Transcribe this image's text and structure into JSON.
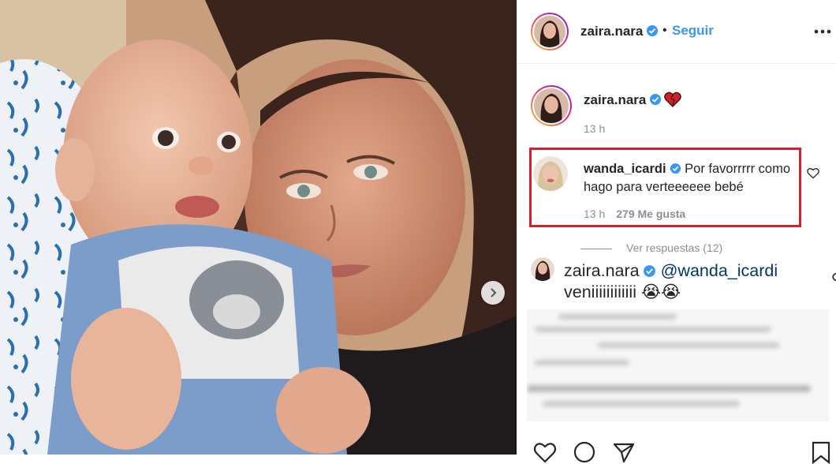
{
  "header": {
    "username": "zaira.nara",
    "separator": "•",
    "follow_label": "Seguir",
    "more_icon": "ellipsis-icon"
  },
  "caption": {
    "username": "zaira.nara",
    "emoji": "heart-emoji",
    "time": "13 h"
  },
  "highlighted_comment": {
    "username": "wanda_icardi",
    "text": "Por favorrrrr como hago para verteeeeee bebé",
    "time": "13 h",
    "likes": "279 Me gusta"
  },
  "replies": {
    "label": "Ver respuestas (12)"
  },
  "reply": {
    "username": "zaira.nara",
    "mention": "@wanda_icardi",
    "text": "veniiiiiiiiiiii",
    "emoji": "😭😭"
  },
  "colors": {
    "follow_blue": "#3897f0",
    "verified_blue": "#3897f0",
    "highlight_red": "#e11b2a",
    "mention_blue": "#00376b"
  }
}
